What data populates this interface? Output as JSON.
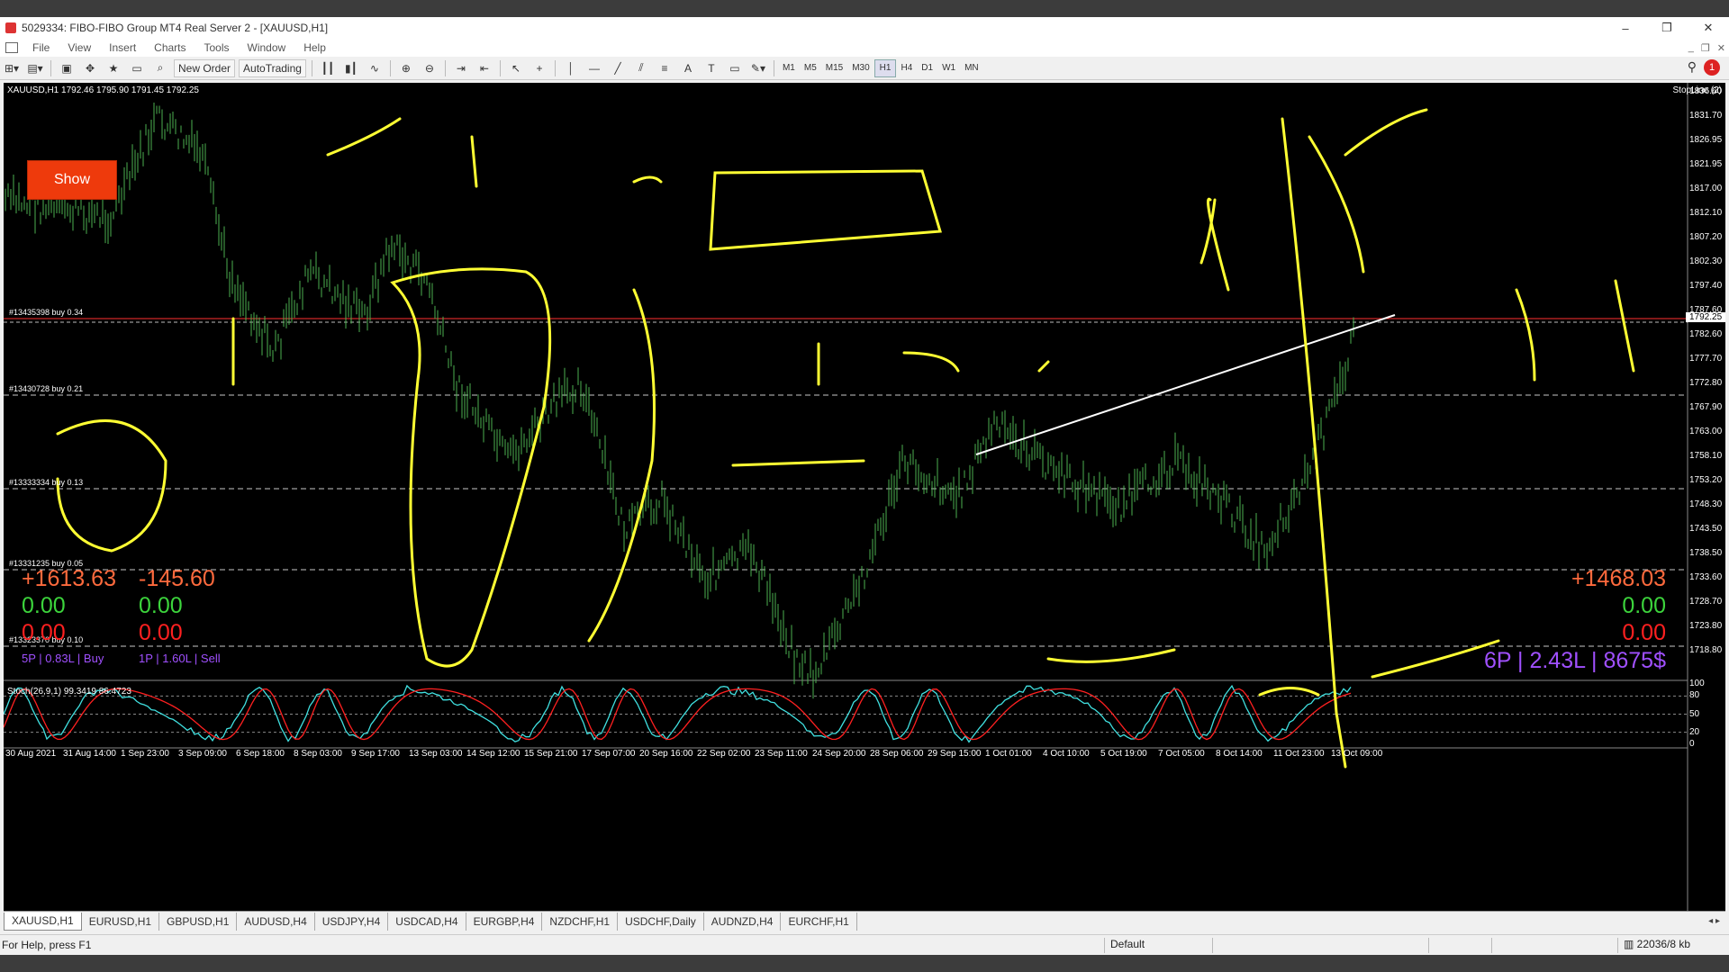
{
  "window": {
    "title": "5029334: FIBO-FIBO Group MT4 Real Server 2 - [XAUUSD,H1]",
    "minimize": "–",
    "restore": "❐",
    "close": "✕"
  },
  "menu": [
    "File",
    "View",
    "Insert",
    "Charts",
    "Tools",
    "Window",
    "Help"
  ],
  "toolbar": {
    "new_order": "New Order",
    "autotrading": "AutoTrading",
    "timeframes": [
      "M1",
      "M5",
      "M15",
      "M30",
      "H1",
      "H4",
      "D1",
      "W1",
      "MN"
    ],
    "active_timeframe": "H1",
    "notification_count": "1"
  },
  "chart": {
    "header": "XAUUSD,H1  1792.46 1795.90 1791.45 1792.25",
    "stopline": "StopLine (2)",
    "show_button": "Show",
    "current_price": "1792.25",
    "price_axis": [
      "1836.60",
      "1831.70",
      "1826.95",
      "1821.95",
      "1817.00",
      "1812.10",
      "1807.20",
      "1802.30",
      "1797.40",
      "1787.60",
      "1782.60",
      "1777.70",
      "1772.80",
      "1767.90",
      "1763.00",
      "1758.10",
      "1753.20",
      "1748.30",
      "1743.50",
      "1738.50",
      "1733.60",
      "1728.70",
      "1723.80",
      "1718.80"
    ],
    "order_lines": [
      {
        "label": "#13435398 buy 0.34",
        "color": "#ff3030"
      },
      {
        "label": "#13430728 buy 0.21",
        "color": "#c8c8c8"
      },
      {
        "label": "#13333334 buy 0.13",
        "color": "#c8c8c8"
      },
      {
        "label": "#13331235 buy 0.05",
        "color": "#c8c8c8"
      },
      {
        "label": "#13323370 buy 0.10",
        "color": "#c8c8c8"
      }
    ],
    "pnl_left": {
      "buy_profit": "+1613.63",
      "sell_profit": "-145.60",
      "buy_zero1": "0.00",
      "sell_zero1": "0.00",
      "buy_zero2": "0.00",
      "sell_zero2": "0.00",
      "buy_summary": "5P | 0.83L | Buy",
      "sell_summary": "1P | 1.60L | Sell"
    },
    "pnl_right": {
      "total": "+1468.03",
      "zero1": "0.00",
      "zero2": "0.00",
      "summary": "6P | 2.43L | 8675$"
    },
    "indicator": {
      "header": "Stoch(26,9,1) 99.3419 86.4723",
      "levels": [
        "100",
        "80",
        "50",
        "20",
        "0"
      ]
    },
    "time_axis": [
      "30 Aug 2021",
      "31 Aug 14:00",
      "1 Sep 23:00",
      "3 Sep 09:00",
      "6 Sep 18:00",
      "8 Sep 03:00",
      "9 Sep 17:00",
      "13 Sep 03:00",
      "14 Sep 12:00",
      "15 Sep 21:00",
      "17 Sep 07:00",
      "20 Sep 16:00",
      "22 Sep 02:00",
      "23 Sep 11:00",
      "24 Sep 20:00",
      "28 Sep 06:00",
      "29 Sep 15:00",
      "1 Oct 01:00",
      "4 Oct 10:00",
      "5 Oct 19:00",
      "7 Oct 05:00",
      "8 Oct 14:00",
      "11 Oct 23:00",
      "13 Oct 09:00"
    ]
  },
  "colors": {
    "up_profit": "#ff6a3d",
    "zero_green": "#3cd43c",
    "zero_red": "#ff2020",
    "summary_purple": "#a050ff",
    "candles": "#4caf50",
    "annotation": "#ffff33",
    "stoch_main": "#40e0e0",
    "stoch_signal": "#ff2020"
  },
  "tabs": [
    "XAUUSD,H1",
    "EURUSD,H1",
    "GBPUSD,H1",
    "AUDUSD,H4",
    "USDJPY,H4",
    "USDCAD,H4",
    "EURGBP,H4",
    "NZDCHF,H1",
    "USDCHF,Daily",
    "AUDNZD,H4",
    "EURCHF,H1"
  ],
  "status": {
    "help": "For Help, press F1",
    "profile": "Default",
    "traffic": "22036/8 kb"
  }
}
